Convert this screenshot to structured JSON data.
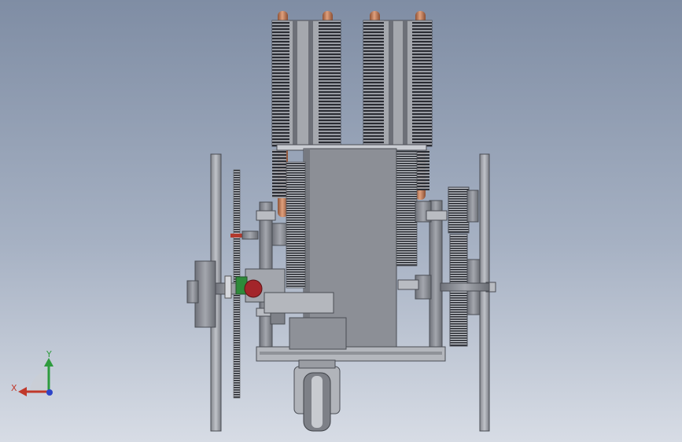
{
  "viewport": {
    "colors": {
      "bg_top": "#7f8da4",
      "bg_bottom": "#d7dce5",
      "metal": "#8e9199",
      "metal_dark": "#5d6068",
      "copper": "#c8805e",
      "fin": "#2a2c33",
      "red_knob": "#a3252a",
      "bolt_red": "#b23a2e"
    }
  },
  "triad": {
    "x_label": "X",
    "y_label": "Y",
    "x_color": "#c0392b",
    "y_color": "#2e9b3e",
    "z_color": "#2d44c8"
  }
}
